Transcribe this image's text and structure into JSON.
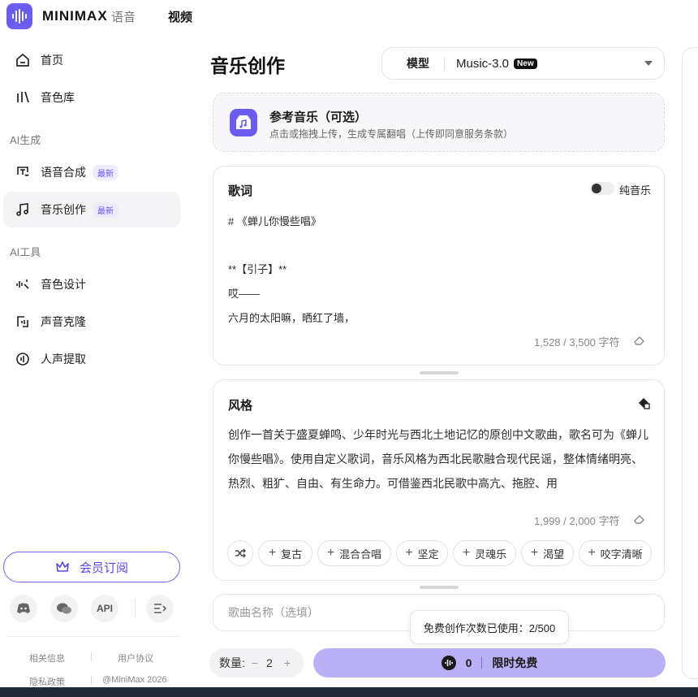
{
  "header": {
    "brand": "MINIMAX",
    "nav": [
      "语音",
      "视频"
    ]
  },
  "sidebar": {
    "items_top": [
      {
        "label": "首页",
        "icon": "home-icon"
      },
      {
        "label": "音色库",
        "icon": "voice-library-icon"
      }
    ],
    "section_ai_gen": "AI生成",
    "items_gen": [
      {
        "label": "语音合成",
        "badge": "最新",
        "icon": "speech-synthesis-icon"
      },
      {
        "label": "音乐创作",
        "badge": "最新",
        "icon": "music-note-icon",
        "active": true
      }
    ],
    "section_ai_tools": "AI工具",
    "items_tools": [
      {
        "label": "音色设计",
        "icon": "voice-design-icon"
      },
      {
        "label": "声音克隆",
        "icon": "voice-clone-icon"
      },
      {
        "label": "人声提取",
        "icon": "vocal-extract-icon"
      }
    ],
    "vip_label": "会员订阅",
    "social": [
      "discord-icon",
      "wechat-icon",
      "API",
      "menu-collapse-icon"
    ],
    "api_label": "API",
    "footer": {
      "related": "相关信息",
      "agreement": "用户协议",
      "privacy": "隐私政策",
      "copyright": "@MiniMax 2026"
    }
  },
  "main": {
    "title": "音乐创作",
    "model": {
      "label": "模型",
      "value": "Music-3.0",
      "badge": "New"
    },
    "upload": {
      "title": "参考音乐（可选）",
      "subtitle": "点击或拖拽上传，生成专属翻唱（上传即同意服务条款）"
    },
    "lyrics": {
      "title": "歌词",
      "toggle_label": "纯音乐",
      "lines": [
        "# 《蝉儿你慢些唱》",
        "**【引子】**",
        "哎——",
        "六月的太阳嘛，晒红了墙，"
      ],
      "counter": "1,528 / 3,500 字符"
    },
    "style": {
      "title": "风格",
      "text": "创作一首关于盛夏蝉鸣、少年时光与西北土地记忆的原创中文歌曲，歌名可为《蝉儿你慢些唱》。使用自定义歌词，音乐风格为西北民歌融合现代民谣，整体情绪明亮、热烈、粗犷、自由、有生命力。可借鉴西北民歌中高亢、拖腔、用",
      "counter": "1,999 / 2,000 字符",
      "chips": [
        "复古",
        "混合合唱",
        "坚定",
        "灵魂乐",
        "渴望",
        "咬字清晰"
      ]
    },
    "song_name_placeholder": "歌曲名称（选填）",
    "tooltip": "免费创作次数已使用：2/500",
    "quantity": {
      "label": "数量:",
      "minus": "−",
      "value": "2",
      "plus": "+"
    },
    "generate": {
      "count": "0",
      "label": "限时免费"
    }
  },
  "colors": {
    "accent": "#6d5cf0",
    "button": "#b9b0f5"
  }
}
